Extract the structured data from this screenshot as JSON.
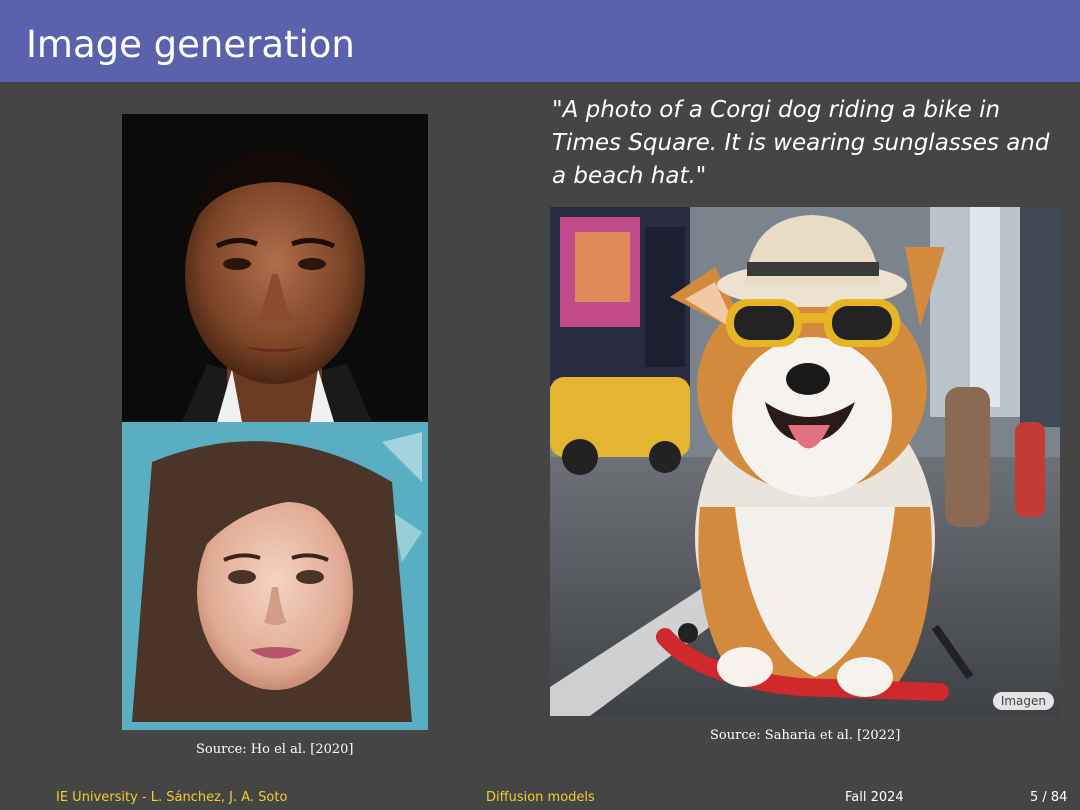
{
  "slide": {
    "title": "Image generation"
  },
  "left_column": {
    "images": [
      {
        "subject": "man-face",
        "background": "#0c0c0c"
      },
      {
        "subject": "woman-face",
        "background": "#5aaec1"
      }
    ],
    "caption": "Source: Ho el al. [2020]"
  },
  "right_column": {
    "prompt": "\"A photo of a Corgi dog riding a bike in Times Square. It is wearing sunglasses and a beach hat.\"",
    "caption": "Source: Saharia et al. [2022]",
    "badge": "Imagen"
  },
  "footer": {
    "authors": "IE University - L. Sánchez, J. A. Soto",
    "topic": "Diffusion models",
    "term": "Fall 2024",
    "page": "5 / 84"
  },
  "colors": {
    "title_bar": "#5b62ad",
    "background": "#454545",
    "footer_accent": "#f2cf2b"
  }
}
